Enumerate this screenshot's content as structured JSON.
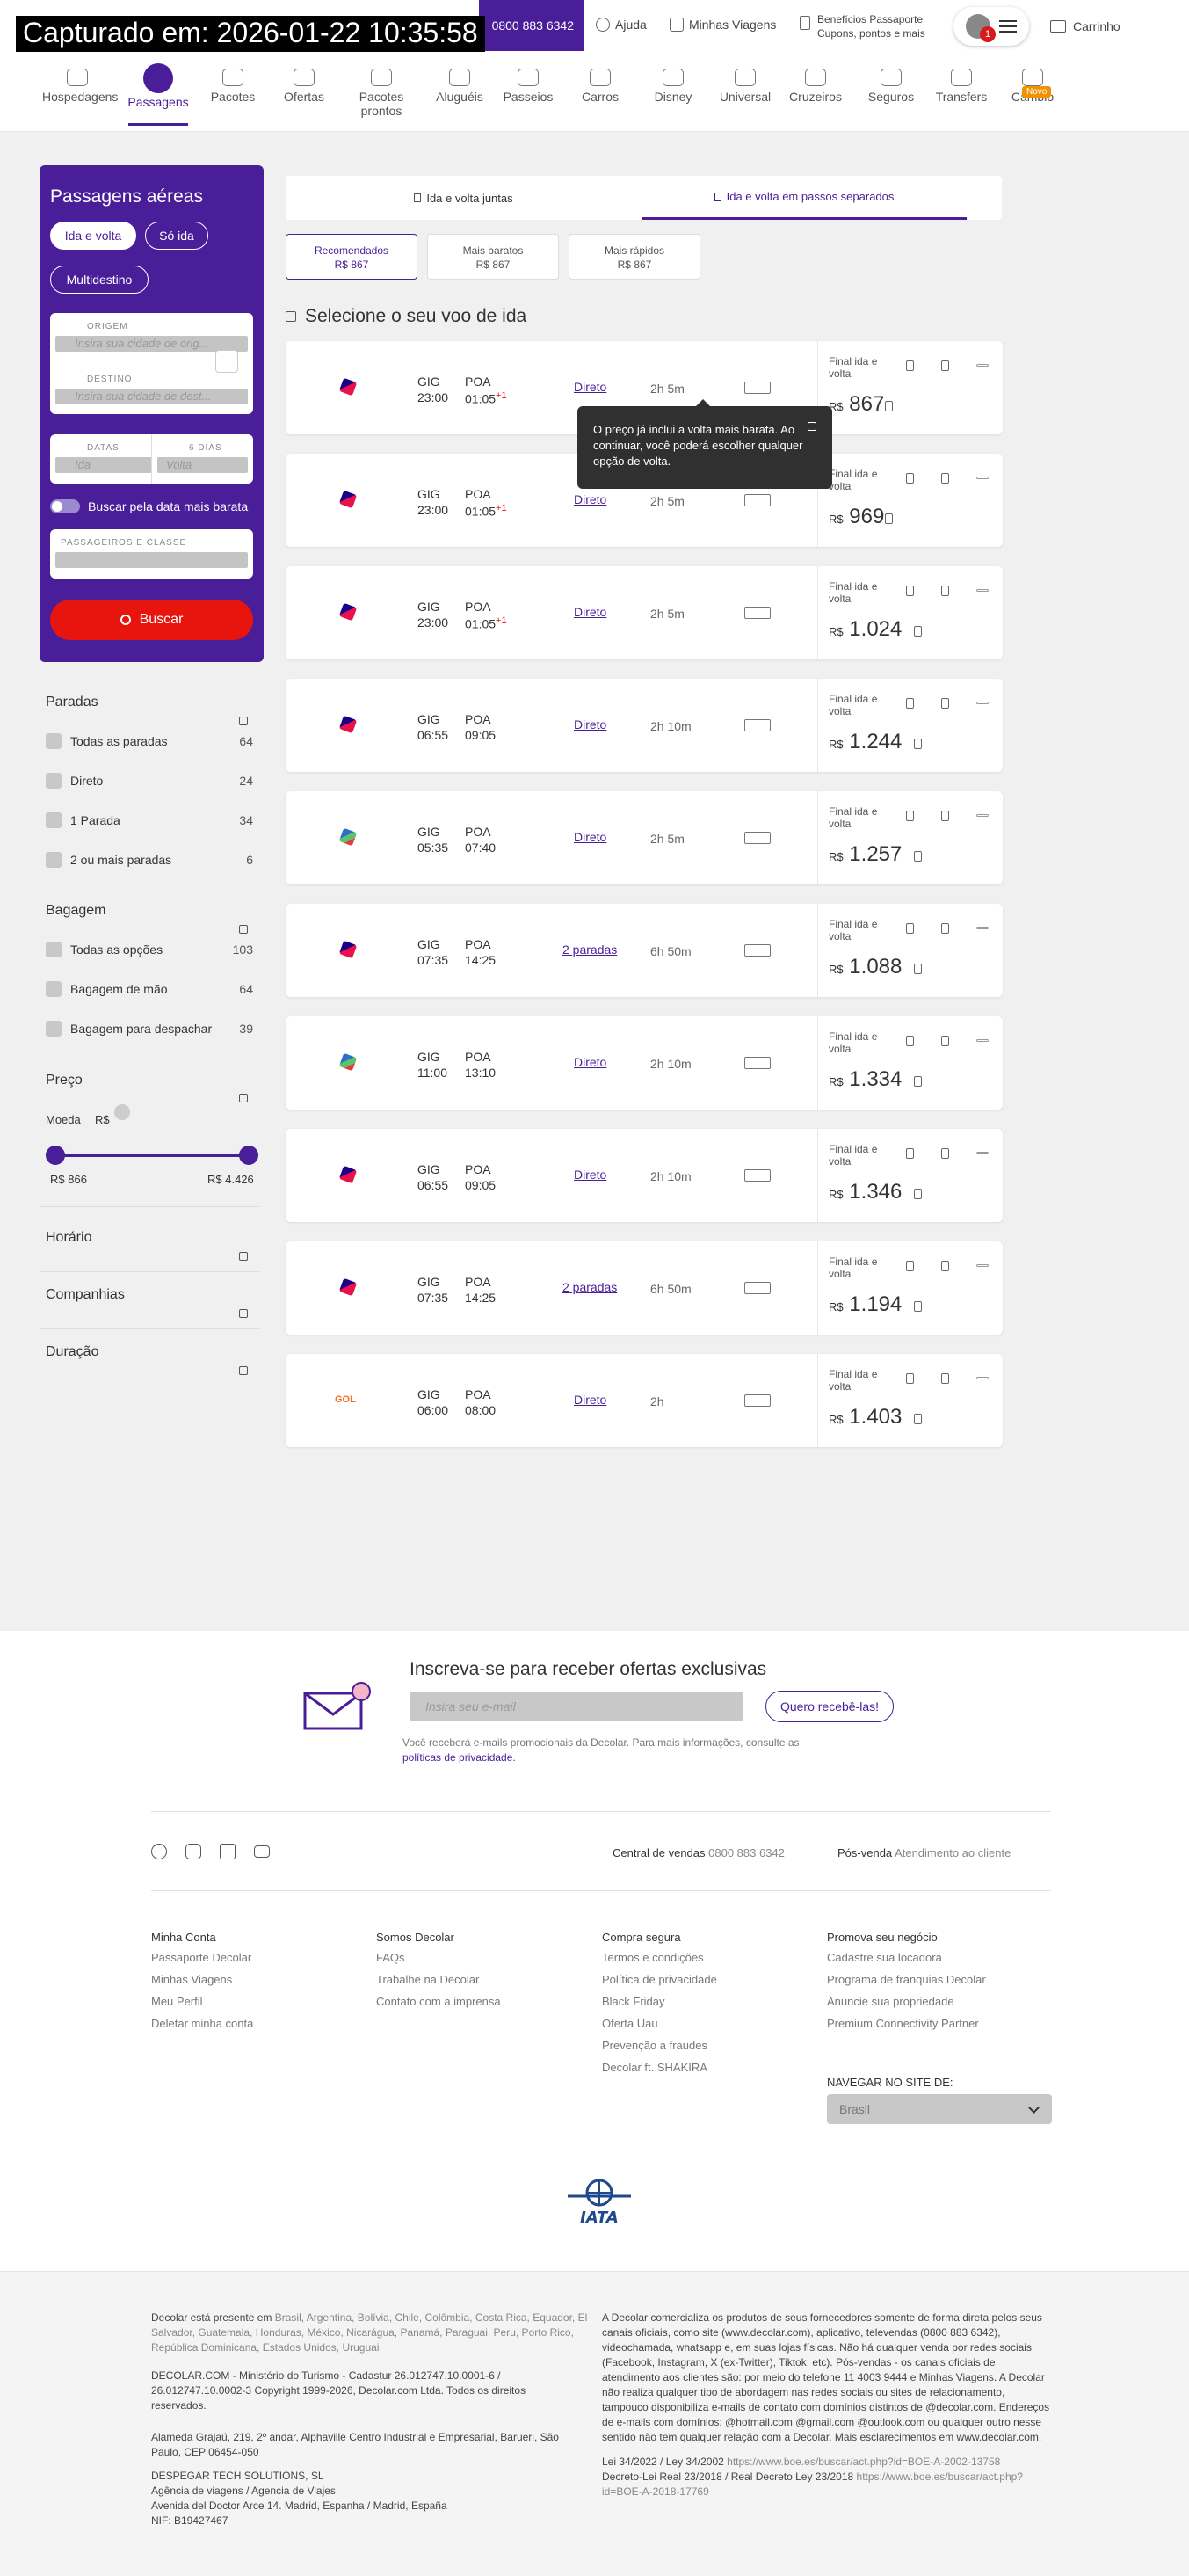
{
  "timestamp": "Capturado em: 2026-01-22 10:35:58",
  "header": {
    "phone": "0800 883 6342",
    "help": "Ajuda",
    "my_trips": "Minhas Viagens",
    "benefits_line1": "Benefícios Passaporte",
    "benefits_line2": "Cupons, pontos e mais",
    "notification_count": "1",
    "cart": "Carrinho",
    "nav": [
      {
        "label": "Hospedagens",
        "icon": "bed-icon"
      },
      {
        "label": "Passagens",
        "icon": "plane-icon"
      },
      {
        "label": "Pacotes",
        "icon": "suitcase-icon"
      },
      {
        "label": "Ofertas",
        "icon": "flame-icon"
      },
      {
        "label": "Pacotes",
        "label2": "prontos",
        "icon": "package-icon"
      },
      {
        "label": "Aluguéis",
        "icon": "house-icon"
      },
      {
        "label": "Passeios",
        "icon": "ticket-icon"
      },
      {
        "label": "Carros",
        "icon": "car-icon"
      },
      {
        "label": "Disney",
        "icon": "mickey-icon"
      },
      {
        "label": "Universal",
        "icon": "globe-icon"
      },
      {
        "label": "Cruzeiros",
        "icon": "ship-icon"
      },
      {
        "label": "Seguros",
        "icon": "shield-icon"
      },
      {
        "label": "Transfers",
        "icon": "bus-icon"
      },
      {
        "label": "Câmbio",
        "icon": "exchange-icon",
        "badge": "Novo"
      }
    ]
  },
  "search": {
    "title": "Passagens aéreas",
    "trip_types": [
      "Ida e volta",
      "Só ida",
      "Multidestino"
    ],
    "origin_label": "ORIGEM",
    "origin_placeholder": "Insira sua cidade de orig...",
    "destination_label": "DESTINO",
    "destination_placeholder": "Insira sua cidade de dest...",
    "dates_label": "DATAS",
    "days_label": "6 DIAS",
    "departure_placeholder": "Ida",
    "return_placeholder": "Volta",
    "cheapest_toggle": "Buscar pela data mais barata",
    "passengers_label": "PASSAGEIROS E CLASSE",
    "search_button": "Buscar"
  },
  "filters": {
    "stops": {
      "title": "Paradas",
      "options": [
        {
          "label": "Todas as paradas",
          "count": "64"
        },
        {
          "label": "Direto",
          "count": "24"
        },
        {
          "label": "1 Parada",
          "count": "34"
        },
        {
          "label": "2 ou mais paradas",
          "count": "6"
        }
      ]
    },
    "baggage": {
      "title": "Bagagem",
      "options": [
        {
          "label": "Todas as opções",
          "count": "103"
        },
        {
          "label": "Bagagem de mão",
          "count": "64"
        },
        {
          "label": "Bagagem para despachar",
          "count": "39"
        }
      ]
    },
    "price": {
      "title": "Preço",
      "currency_label": "Moeda",
      "currency": "R$",
      "min": "R$ 866",
      "max": "R$ 4.426",
      "range_selected": [
        0,
        1
      ]
    },
    "schedule": "Horário",
    "airlines": "Companhias",
    "duration": "Duração"
  },
  "results": {
    "trip_tabs": [
      "Ida e volta juntas",
      "Ida e volta em passos separados"
    ],
    "sort": [
      {
        "label": "Recomendados",
        "price": "R$ 867"
      },
      {
        "label": "Mais baratos",
        "price": "R$ 867"
      },
      {
        "label": "Mais rápidos",
        "price": "R$ 867"
      }
    ],
    "section_title": "Selecione o seu voo de ida",
    "tooltip": "O preço já inclui a volta mais barata. Ao continuar, você poderá escolher qualquer opção de volta.",
    "final_label_1": "Final ida e",
    "final_label_2": "volta",
    "currency": "R$",
    "flights": [
      {
        "airline": "LATAM",
        "from": "GIG",
        "dep": "23:00",
        "to": "POA",
        "arr": "01:05",
        "plus": "+1",
        "stops": "Direto",
        "duration": "2h 5m",
        "price": "867"
      },
      {
        "airline": "LATAM",
        "from": "GIG",
        "dep": "23:00",
        "to": "POA",
        "arr": "01:05",
        "plus": "+1",
        "stops": "Direto",
        "duration": "2h 5m",
        "price": "969"
      },
      {
        "airline": "LATAM",
        "from": "GIG",
        "dep": "23:00",
        "to": "POA",
        "arr": "01:05",
        "plus": "+1",
        "stops": "Direto",
        "duration": "2h 5m",
        "price": "1.024"
      },
      {
        "airline": "LATAM",
        "from": "GIG",
        "dep": "06:55",
        "to": "POA",
        "arr": "09:05",
        "plus": "",
        "stops": "Direto",
        "duration": "2h 10m",
        "price": "1.244"
      },
      {
        "airline": "Azul",
        "from": "GIG",
        "dep": "05:35",
        "to": "POA",
        "arr": "07:40",
        "plus": "",
        "stops": "Direto",
        "duration": "2h 5m",
        "price": "1.257"
      },
      {
        "airline": "LATAM",
        "from": "GIG",
        "dep": "07:35",
        "to": "POA",
        "arr": "14:25",
        "plus": "",
        "stops": "2 paradas",
        "duration": "6h 50m",
        "price": "1.088"
      },
      {
        "airline": "Azul",
        "from": "GIG",
        "dep": "11:00",
        "to": "POA",
        "arr": "13:10",
        "plus": "",
        "stops": "Direto",
        "duration": "2h 10m",
        "price": "1.334"
      },
      {
        "airline": "LATAM",
        "from": "GIG",
        "dep": "06:55",
        "to": "POA",
        "arr": "09:05",
        "plus": "",
        "stops": "Direto",
        "duration": "2h 10m",
        "price": "1.346"
      },
      {
        "airline": "LATAM",
        "from": "GIG",
        "dep": "07:35",
        "to": "POA",
        "arr": "14:25",
        "plus": "",
        "stops": "2 paradas",
        "duration": "6h 50m",
        "price": "1.194"
      },
      {
        "airline": "GOL",
        "from": "GIG",
        "dep": "06:00",
        "to": "POA",
        "arr": "08:00",
        "plus": "",
        "stops": "Direto",
        "duration": "2h",
        "price": "1.403"
      }
    ]
  },
  "newsletter": {
    "title": "Inscreva-se para receber ofertas exclusivas",
    "placeholder": "Insira seu e-mail",
    "button": "Quero recebê-las!",
    "note": "Você receberá e-mails promocionais da Decolar. Para mais informações, consulte as",
    "privacy_link": "políticas de privacidade."
  },
  "footer": {
    "central_label": "Central de vendas",
    "central_phone": "0800 883 6342",
    "posvenda_label": "Pós-venda",
    "posvenda_link": "Atendimento ao cliente",
    "columns": [
      {
        "title": "Minha Conta",
        "links": [
          "Passaporte Decolar",
          "Minhas Viagens",
          "Meu Perfil",
          "Deletar minha conta"
        ]
      },
      {
        "title": "Somos Decolar",
        "links": [
          "FAQs",
          "Trabalhe na Decolar",
          "Contato com a imprensa"
        ]
      },
      {
        "title": "Compra segura",
        "links": [
          "Termos e condições",
          "Política de privacidade",
          "Black Friday",
          "Oferta Uau",
          "Prevenção a fraudes",
          "Decolar ft. SHAKIRA"
        ]
      },
      {
        "title": "Promova seu negócio",
        "links": [
          "Cadastre sua locadora",
          "Programa de franquias Decolar",
          "Anuncie sua propriedade",
          "Premium Connectivity Partner"
        ]
      }
    ],
    "navigate_label": "NAVEGAR NO SITE DE:",
    "navigate_value": "Brasil",
    "iata": "IATA"
  },
  "legal": {
    "presence_label": "Decolar está presente em",
    "presence_countries": "Brasil, Argentina, Bolívia, Chile, Colômbia, Costa Rica, Equador, El Salvador, Guatemala, Honduras, México, Nicarágua, Panamá, Paraguai, Peru, Porto Rico, República Dominicana, Estados Unidos, Uruguai",
    "registry_1": "DECOLAR.COM - Ministério do Turismo - Cadastur 26.012747.10.0001-6 /",
    "registry_2": "26.012747.10.0002-3 Copyright 1999-2026, Decolar.com Ltda. Todos os direitos",
    "registry_3": "reservados.",
    "address_1": "Alameda Grajaú, 219, 2º andar, Alphaville Centro Industrial e Empresarial, Barueri, São",
    "address_2": "Paulo, CEP 06454-050",
    "despegar_1": "DESPEGAR TECH SOLUTIONS, SL",
    "despegar_2": "Agência de viagens / Agencia de Viajes",
    "despegar_3": "Avenida del Doctor Arce 14. Madrid, Espanha / Madrid, España",
    "despegar_4": "NIF: B19427467",
    "disclaimer": "A Decolar comercializa os produtos de seus fornecedores somente de forma direta pelos seus canais oficiais, como site (www.decolar.com), aplicativo, televendas (0800 883 6342), videochamada, whatsapp e, em suas lojas físicas. Não há qualquer venda por redes sociais (Facebook, Instagram, X (ex-Twitter), Tiktok, etc). Pós-vendas - os canais oficiais de atendimento aos clientes são: por meio do telefone 11 4003 9444 e Minhas Viagens. A Decolar não realiza qualquer tipo de abordagem nas redes sociais ou sites de relacionamento, tampouco disponibiliza e-mails de contato com domínios distintos de @decolar.com. Endereços de e-mails com domínios: @hotmail.com @gmail.com @outlook.com ou qualquer outro nesse sentido não tem qualquer relação com a Decolar. Mais esclarecimentos em www.decolar.com.",
    "law_1_label": "Lei 34/2022 / Ley 34/2002",
    "law_1_url": "https://www.boe.es/buscar/act.php?id=BOE-A-2002-13758",
    "law_2_label": "Decreto-Lei Real 23/2018 / Real Decreto Ley 23/2018",
    "law_2_url": "https://www.boe.es/buscar/act.php?id=BOE-A-2018-17769"
  },
  "colors": {
    "brand": "#4a1e99",
    "cta": "#e8150f",
    "badge": "#f39200"
  }
}
